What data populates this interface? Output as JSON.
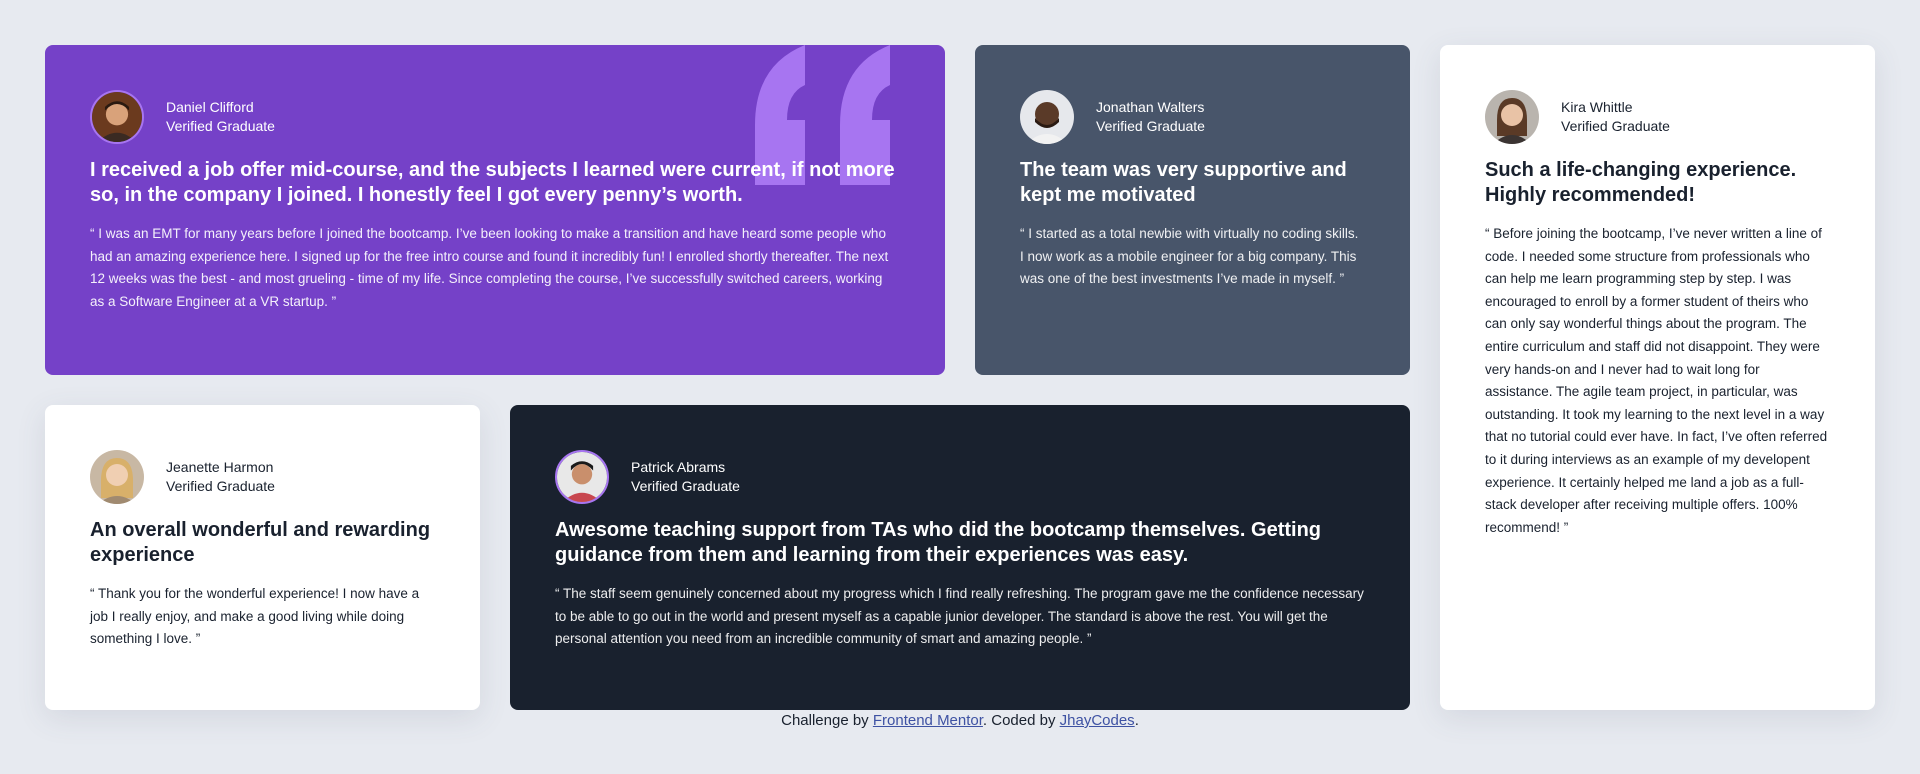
{
  "testimonials": [
    {
      "name": "Daniel Clifford",
      "role": "Verified Graduate",
      "headline": "I received a job offer mid-course, and the subjects I learned were current, if not more so, in the company I joined. I honestly feel I got every penny’s worth.",
      "quote": "“ I was an EMT for many years before I joined the bootcamp. I’ve been looking to make a transition and have heard some people who had an amazing experience here. I signed up for the free intro course and found it incredibly fun! I enrolled shortly thereafter. The next 12 weeks was the best - and most grueling - time of my life. Since completing the course, I’ve successfully switched careers, working as a Software Engineer at a VR startup. ”"
    },
    {
      "name": "Jonathan Walters",
      "role": "Verified Graduate",
      "headline": "The team was very supportive and kept me motivated",
      "quote": "“ I started as a total newbie with virtually no coding skills. I now work as a mobile engineer for a big company. This was one of the best investments I’ve made in myself. ”"
    },
    {
      "name": "Kira Whittle",
      "role": "Verified Graduate",
      "headline": "Such a life-changing experience. Highly recommended!",
      "quote": "“ Before joining the bootcamp, I’ve never written a line of code. I needed some structure from professionals who can help me learn programming step by step. I was encouraged to enroll by a former student of theirs who can only say wonderful things about the program. The entire curriculum and staff did not disappoint. They were very hands-on and I never had to wait long for assistance. The agile team project, in particular, was outstanding. It took my learning to the next level in a way that no tutorial could ever have. In fact, I’ve often referred to it during interviews as an example of my developent experience. It certainly helped me land a job as a full-stack developer after receiving multiple offers. 100% recommend! ”"
    },
    {
      "name": "Jeanette Harmon",
      "role": "Verified Graduate",
      "headline": "An overall wonderful and rewarding experience",
      "quote": "“ Thank you for the wonderful experience! I now have a job I really enjoy, and make a good living while doing something I love. ”"
    },
    {
      "name": "Patrick Abrams",
      "role": "Verified Graduate",
      "headline": "Awesome teaching support from TAs who did the bootcamp themselves. Getting guidance from them and learning from their experiences was easy.",
      "quote": "“ The staff seem genuinely concerned about my progress which I find really refreshing. The program gave me the confidence necessary to be able to go out in the world and present myself as a capable junior developer. The standard is above the rest. You will get the personal attention you need from an incredible community of smart and amazing people. ”"
    }
  ],
  "footer": {
    "prefix": "Challenge by ",
    "link1": "Frontend Mentor",
    "middle": ". Coded by ",
    "link2": "JhayCodes",
    "suffix": "."
  },
  "colors": {
    "purple": "#7541c8",
    "slate": "#48556a",
    "dark": "#19212e",
    "white": "#ffffff",
    "background": "#e7eaf0",
    "quote_mark": "#a775f1",
    "link": "#3e52a3"
  },
  "icons": [
    "quotation-mark-icon",
    "avatar-daniel",
    "avatar-jonathan",
    "avatar-kira",
    "avatar-jeanette",
    "avatar-patrick"
  ]
}
